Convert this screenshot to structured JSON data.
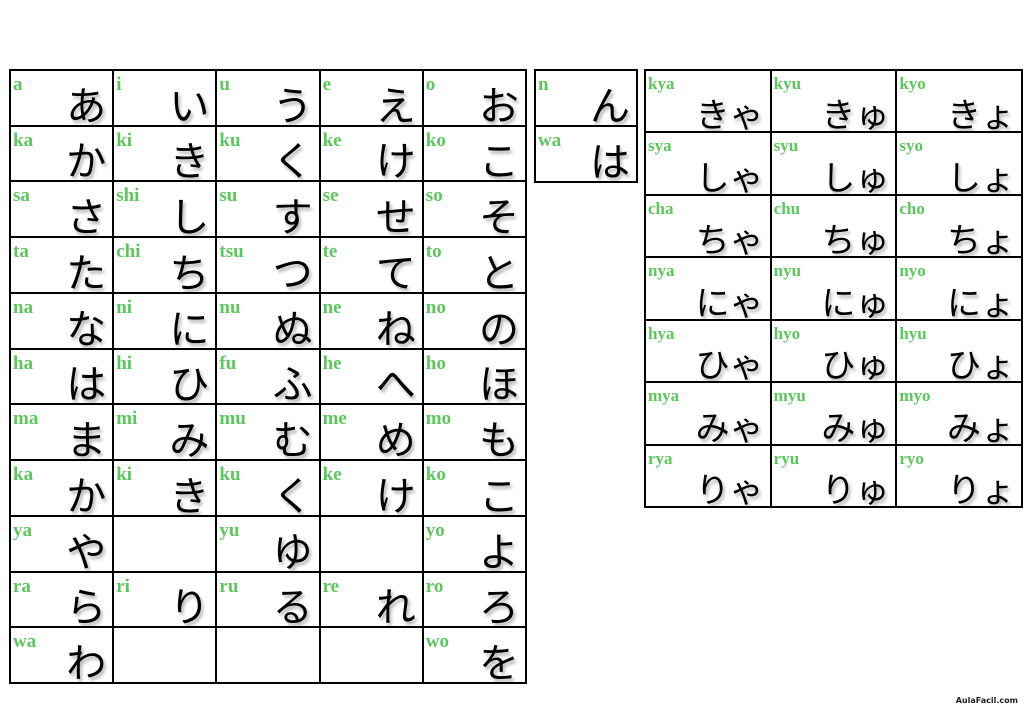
{
  "colors": {
    "romaji": "#5cc85c",
    "kana": "#000000",
    "border": "#000000"
  },
  "main_table": [
    [
      [
        "a",
        "あ"
      ],
      [
        "i",
        "い"
      ],
      [
        "u",
        "う"
      ],
      [
        "e",
        "え"
      ],
      [
        "o",
        "お"
      ]
    ],
    [
      [
        "ka",
        "か"
      ],
      [
        "ki",
        "き"
      ],
      [
        "ku",
        "く"
      ],
      [
        "ke",
        "け"
      ],
      [
        "ko",
        "こ"
      ]
    ],
    [
      [
        "sa",
        "さ"
      ],
      [
        "shi",
        "し"
      ],
      [
        "su",
        "す"
      ],
      [
        "se",
        "せ"
      ],
      [
        "so",
        "そ"
      ]
    ],
    [
      [
        "ta",
        "た"
      ],
      [
        "chi",
        "ち"
      ],
      [
        "tsu",
        "つ"
      ],
      [
        "te",
        "て"
      ],
      [
        "to",
        "と"
      ]
    ],
    [
      [
        "na",
        "な"
      ],
      [
        "ni",
        "に"
      ],
      [
        "nu",
        "ぬ"
      ],
      [
        "ne",
        "ね"
      ],
      [
        "no",
        "の"
      ]
    ],
    [
      [
        "ha",
        "は"
      ],
      [
        "hi",
        "ひ"
      ],
      [
        "fu",
        "ふ"
      ],
      [
        "he",
        "へ"
      ],
      [
        "ho",
        "ほ"
      ]
    ],
    [
      [
        "ma",
        "ま"
      ],
      [
        "mi",
        "み"
      ],
      [
        "mu",
        "む"
      ],
      [
        "me",
        "め"
      ],
      [
        "mo",
        "も"
      ]
    ],
    [
      [
        "ka",
        "か"
      ],
      [
        "ki",
        "き"
      ],
      [
        "ku",
        "く"
      ],
      [
        "ke",
        "け"
      ],
      [
        "ko",
        "こ"
      ]
    ],
    [
      [
        "ya",
        "や"
      ],
      [
        "",
        ""
      ],
      [
        "yu",
        "ゆ"
      ],
      [
        "",
        ""
      ],
      [
        "yo",
        "よ"
      ]
    ],
    [
      [
        "ra",
        "ら"
      ],
      [
        "ri",
        "り"
      ],
      [
        "ru",
        "る"
      ],
      [
        "re",
        "れ"
      ],
      [
        "ro",
        "ろ"
      ]
    ],
    [
      [
        "wa",
        "わ"
      ],
      [
        "",
        ""
      ],
      [
        "",
        ""
      ],
      [
        "",
        ""
      ],
      [
        "wo",
        "を"
      ]
    ]
  ],
  "extra_table": [
    [
      "n",
      "ん"
    ],
    [
      "wa",
      "は"
    ]
  ],
  "combo_table": [
    [
      [
        "kya",
        "きゃ"
      ],
      [
        "kyu",
        "きゅ"
      ],
      [
        "kyo",
        "きょ"
      ]
    ],
    [
      [
        "sya",
        "しゃ"
      ],
      [
        "syu",
        "しゅ"
      ],
      [
        "syo",
        "しょ"
      ]
    ],
    [
      [
        "cha",
        "ちゃ"
      ],
      [
        "chu",
        "ちゅ"
      ],
      [
        "cho",
        "ちょ"
      ]
    ],
    [
      [
        "nya",
        "にゃ"
      ],
      [
        "nyu",
        "にゅ"
      ],
      [
        "nyo",
        "にょ"
      ]
    ],
    [
      [
        "hya",
        "ひゃ"
      ],
      [
        "hyo",
        "ひゅ"
      ],
      [
        "hyu",
        "ひょ"
      ]
    ],
    [
      [
        "mya",
        "みゃ"
      ],
      [
        "myu",
        "みゅ"
      ],
      [
        "myo",
        "みょ"
      ]
    ],
    [
      [
        "rya",
        "りゃ"
      ],
      [
        "ryu",
        "りゅ"
      ],
      [
        "ryo",
        "りょ"
      ]
    ]
  ],
  "watermark": "AulaFacil.com"
}
